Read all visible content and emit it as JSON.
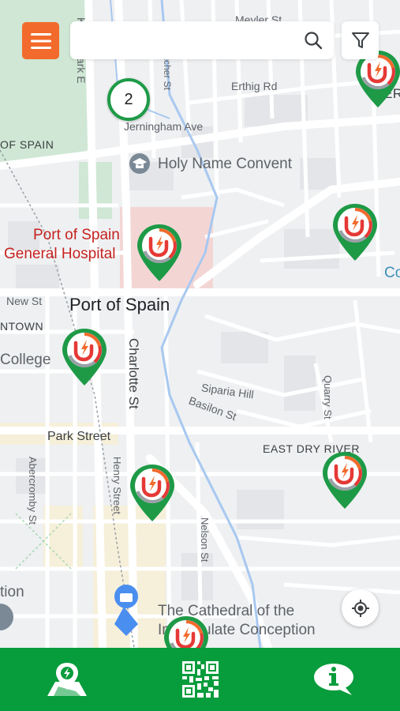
{
  "colors": {
    "brand_green": "#079c3c",
    "pin_green": "#1e9a47",
    "menu_orange": "#f26b2c",
    "pin_ring_orange": "#f26b2c",
    "pin_ring_red": "#e53935",
    "hospital_red": "#c5221f"
  },
  "search": {
    "placeholder": "",
    "value": ""
  },
  "map": {
    "labels": {
      "meyler_st": "Meyler St",
      "erthig_rd": "Erthig Rd",
      "jerningham_ave": "Jerningham Ave",
      "of_spain": "OF SPAIN",
      "holy_name_convent": "Holy Name Convent",
      "hospital_line1": "Port of Spain",
      "hospital_line2": "General Hospital",
      "new_st": "New St",
      "port_of_spain": "Port of Spain",
      "ntown": "NTOWN",
      "college": "College",
      "charlotte_st": "Charlotte St",
      "siparia_hill": "Siparia Hill",
      "basilon_st": "Basilon St",
      "quarry_st": "Quarry St",
      "east_dry_river": "EAST DRY RIVER",
      "park_street": "Park Street",
      "abercromby_st": "Abercromby St",
      "henry_street": "Henry Street",
      "nelson_st": "Nelson St",
      "cathedral_line1": "The Cathedral of the",
      "cathedral_line2": "Immaculate Conception",
      "tion": "tion",
      "kings_park_e": "King's Park E",
      "pitcher_st": "Pitcher St",
      "co": "Co",
      "er": "ER"
    },
    "cluster_count": "2",
    "charger_pins": 8
  },
  "bottom_nav": [
    {
      "name": "map",
      "icon": "map-charging-icon"
    },
    {
      "name": "qr",
      "icon": "qr-code-icon"
    },
    {
      "name": "info",
      "icon": "info-icon"
    }
  ]
}
